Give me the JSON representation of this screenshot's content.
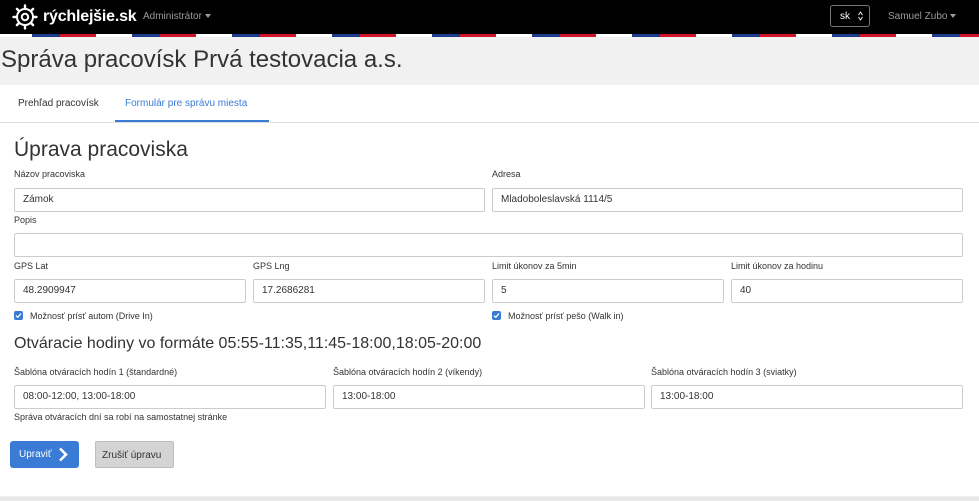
{
  "navbar": {
    "logo_text": "rýchlejšie.sk",
    "admin_menu": "Administrátor",
    "language": "sk",
    "user_menu": "Samuel Zubo"
  },
  "page_title": "Správa pracovísk Prvá testovacia a.s.",
  "tabs": [
    {
      "label": "Prehľad pracovísk",
      "active": false
    },
    {
      "label": "Formulár pre správu miesta",
      "active": true
    }
  ],
  "form": {
    "heading": "Úprava pracoviska",
    "name": {
      "label": "Názov pracoviska",
      "value": "Zámok"
    },
    "address": {
      "label": "Adresa",
      "value": "Mladoboleslavská 1114/5"
    },
    "description": {
      "label": "Popis",
      "value": ""
    },
    "gps_lat": {
      "label": "GPS Lat",
      "value": "48.2909947"
    },
    "gps_lng": {
      "label": "GPS Lng",
      "value": "17.2686281"
    },
    "limit_5min": {
      "label": "Limit úkonov za 5min",
      "value": "5"
    },
    "limit_hour": {
      "label": "Limit úkonov za hodinu",
      "value": "40"
    },
    "drive_in": {
      "label": "Možnosť prísť autom (Drive In)",
      "checked": true
    },
    "walk_in": {
      "label": "Možnosť prísť pešo (Walk in)",
      "checked": true
    },
    "hours_heading": "Otváracie hodiny vo formáte 05:55-11:35,11:45-18:00,18:05-20:00",
    "template1": {
      "label": "Šablóna otváracích hodín 1 (štandardné)",
      "value": "08:00-12:00, 13:00-18:00"
    },
    "template2": {
      "label": "Šablóna otváracích hodín 2 (víkendy)",
      "value": "13:00-18:00"
    },
    "template3": {
      "label": "Šablóna otváracích hodín 3 (sviatky)",
      "value": "13:00-18:00"
    },
    "note": "Správa otváracích dní sa robí na samostatnej stránke",
    "submit_label": "Upraviť",
    "cancel_label": "Zrušiť úpravu"
  },
  "colors": {
    "accent": "#3a7bd5",
    "navbar": "#000000",
    "flag_blue": "#1d3c8e",
    "flag_red": "#d2142b"
  },
  "icons": [
    "logo-gear-icon",
    "caret-down-icon",
    "select-arrows-icon",
    "checkbox-check-icon",
    "chevron-right-icon"
  ]
}
